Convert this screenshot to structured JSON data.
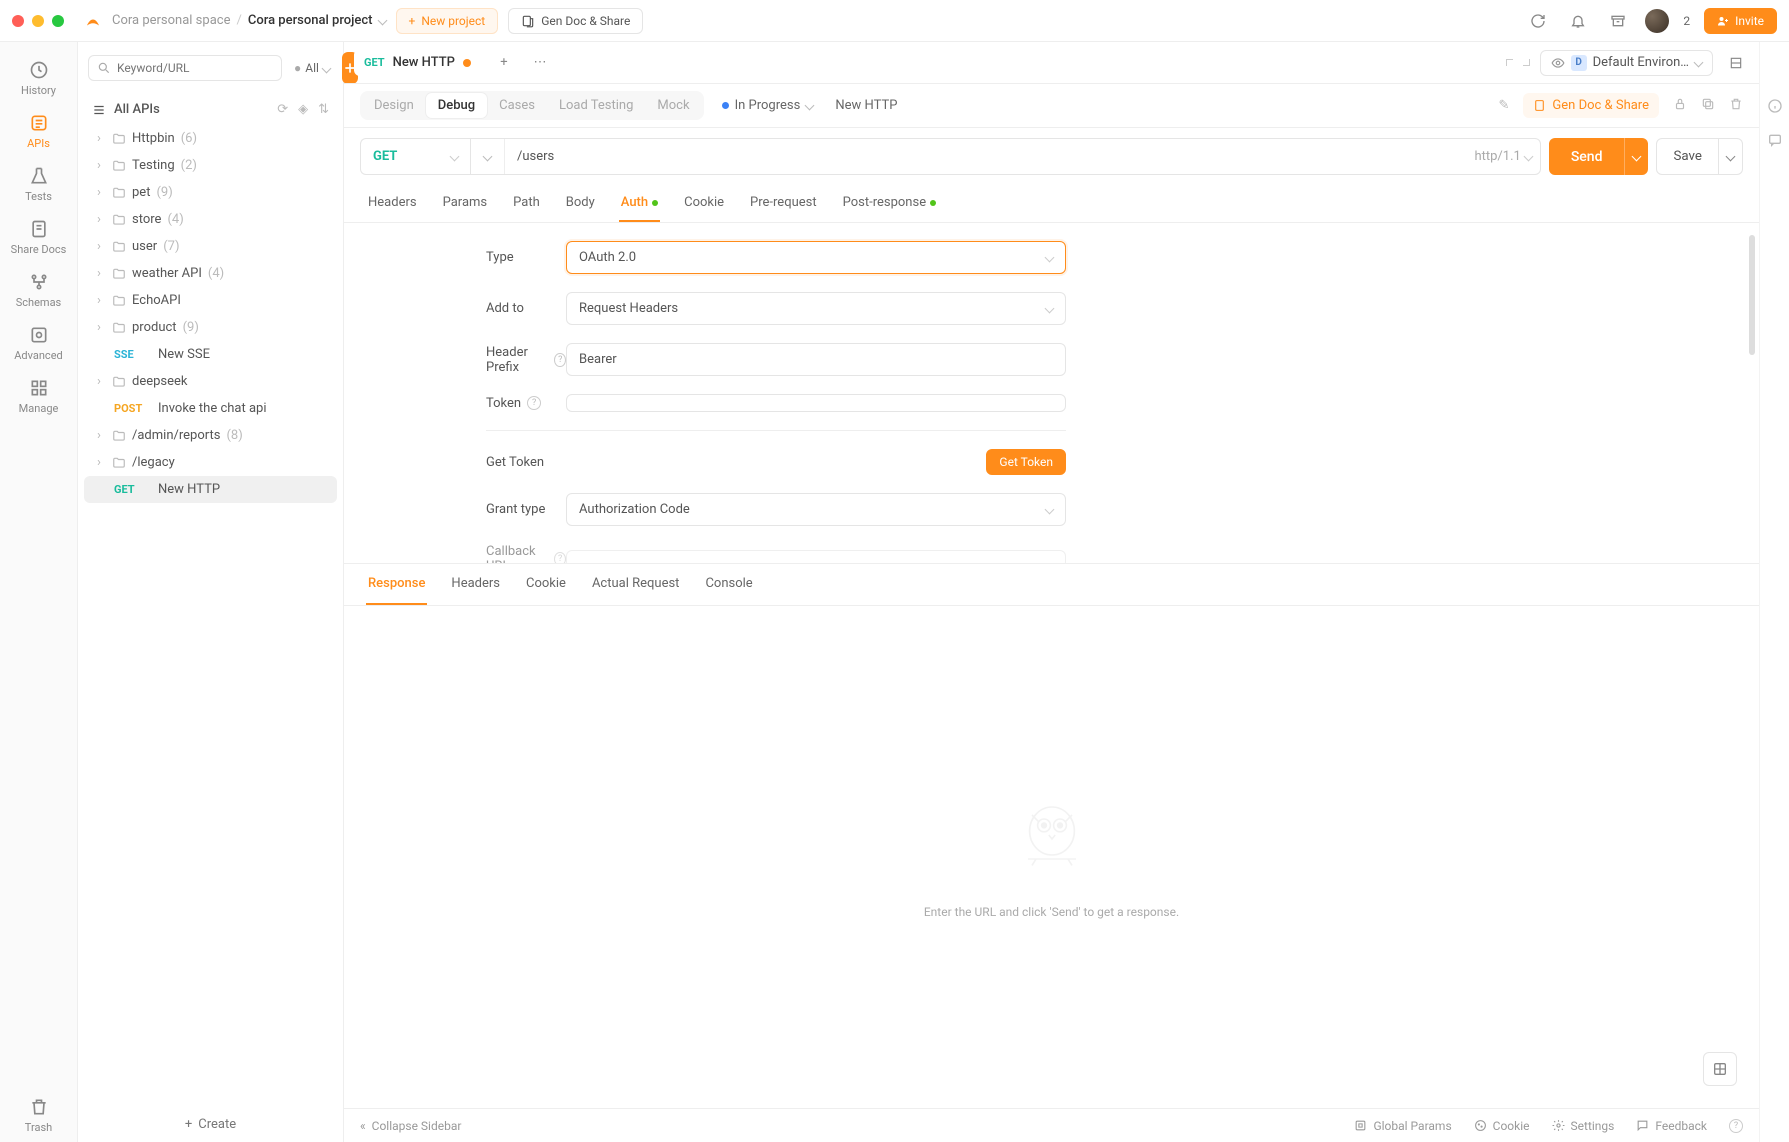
{
  "titlebar": {
    "workspace": "Cora personal space",
    "project": "Cora personal project",
    "new_project": "New project",
    "gen_doc": "Gen Doc & Share",
    "badge": "2",
    "invite": "Invite"
  },
  "rail": {
    "history": "History",
    "apis": "APIs",
    "tests": "Tests",
    "share_docs": "Share Docs",
    "schemas": "Schemas",
    "advanced": "Advanced",
    "manage": "Manage",
    "trash": "Trash"
  },
  "sidebar": {
    "search_placeholder": "Keyword/URL",
    "all": "All",
    "all_apis": "All APIs",
    "create": "Create",
    "items": [
      {
        "type": "folder",
        "name": "Httpbin",
        "count": "(6)"
      },
      {
        "type": "folder",
        "name": "Testing",
        "count": "(2)"
      },
      {
        "type": "folder",
        "name": "pet",
        "count": "(9)"
      },
      {
        "type": "folder",
        "name": "store",
        "count": "(4)"
      },
      {
        "type": "folder",
        "name": "user",
        "count": "(7)"
      },
      {
        "type": "folder",
        "name": "weather API",
        "count": "(4)"
      },
      {
        "type": "folder",
        "name": "EchoAPI",
        "count": ""
      },
      {
        "type": "folder",
        "name": "product",
        "count": "(9)"
      },
      {
        "type": "request",
        "method": "SSE",
        "name": "New SSE"
      },
      {
        "type": "folder",
        "name": "deepseek",
        "count": ""
      },
      {
        "type": "request",
        "method": "POST",
        "name": "Invoke the chat api"
      },
      {
        "type": "folder",
        "name": "/admin/reports",
        "count": "(8)"
      },
      {
        "type": "folder",
        "name": "/legacy",
        "count": ""
      },
      {
        "type": "request",
        "method": "GET",
        "name": "New HTTP",
        "selected": true
      }
    ]
  },
  "main": {
    "tab": {
      "method": "GET",
      "title": "New HTTP"
    },
    "env": "Default Environ…",
    "subnav": {
      "design": "Design",
      "debug": "Debug",
      "cases": "Cases",
      "load": "Load Testing",
      "mock": "Mock",
      "status": "In Progress",
      "name": "New HTTP",
      "gen": "Gen Doc & Share"
    },
    "request": {
      "method": "GET",
      "url": "/users",
      "proto": "http/1.1",
      "send": "Send",
      "save": "Save"
    },
    "req_tabs": {
      "headers": "Headers",
      "params": "Params",
      "path": "Path",
      "body": "Body",
      "auth": "Auth",
      "cookie": "Cookie",
      "pre": "Pre-request",
      "post": "Post-response"
    },
    "auth": {
      "type_label": "Type",
      "type_value": "OAuth 2.0",
      "addto_label": "Add to",
      "addto_value": "Request Headers",
      "prefix_label": "Header Prefix",
      "prefix_value": "Bearer",
      "token_label": "Token",
      "token_value": "",
      "get_token_label": "Get Token",
      "get_token_btn": "Get Token",
      "grant_label": "Grant type",
      "grant_value": "Authorization Code",
      "callback_label": "Callback URL"
    },
    "resp_tabs": {
      "response": "Response",
      "headers": "Headers",
      "cookie": "Cookie",
      "actual": "Actual Request",
      "console": "Console"
    },
    "resp_hint": "Enter the URL and click 'Send' to get a response."
  },
  "statusbar": {
    "collapse": "Collapse Sidebar",
    "global": "Global Params",
    "cookie": "Cookie",
    "settings": "Settings",
    "feedback": "Feedback"
  }
}
